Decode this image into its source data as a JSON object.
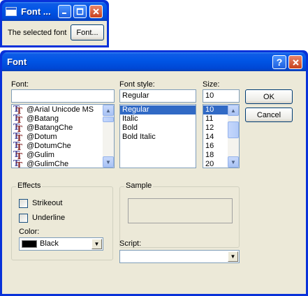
{
  "small_window": {
    "title": "Font ...",
    "label": "The selected font",
    "button": "Font..."
  },
  "dialog": {
    "title": "Font",
    "font": {
      "label": "Font:",
      "value": "",
      "items": [
        "@Arial Unicode MS",
        "@Batang",
        "@BatangChe",
        "@Dotum",
        "@DotumChe",
        "@Gulim",
        "@GulimChe"
      ]
    },
    "style": {
      "label": "Font style:",
      "value": "Regular",
      "items": [
        "Regular",
        "Italic",
        "Bold",
        "Bold Italic"
      ],
      "selected_index": 0
    },
    "size": {
      "label": "Size:",
      "value": "10",
      "items": [
        "10",
        "11",
        "12",
        "14",
        "16",
        "18",
        "20"
      ],
      "selected_index": 0
    },
    "ok_label": "OK",
    "cancel_label": "Cancel",
    "effects": {
      "title": "Effects",
      "strikeout": "Strikeout",
      "underline": "Underline",
      "color_label": "Color:",
      "color_value": "Black",
      "swatch": "#000000"
    },
    "sample": {
      "title": "Sample"
    },
    "script": {
      "label": "Script:",
      "value": ""
    }
  },
  "colors": {
    "titlebar": "#0054e3",
    "selection": "#316ac5",
    "dialog_face": "#ece9d8"
  }
}
